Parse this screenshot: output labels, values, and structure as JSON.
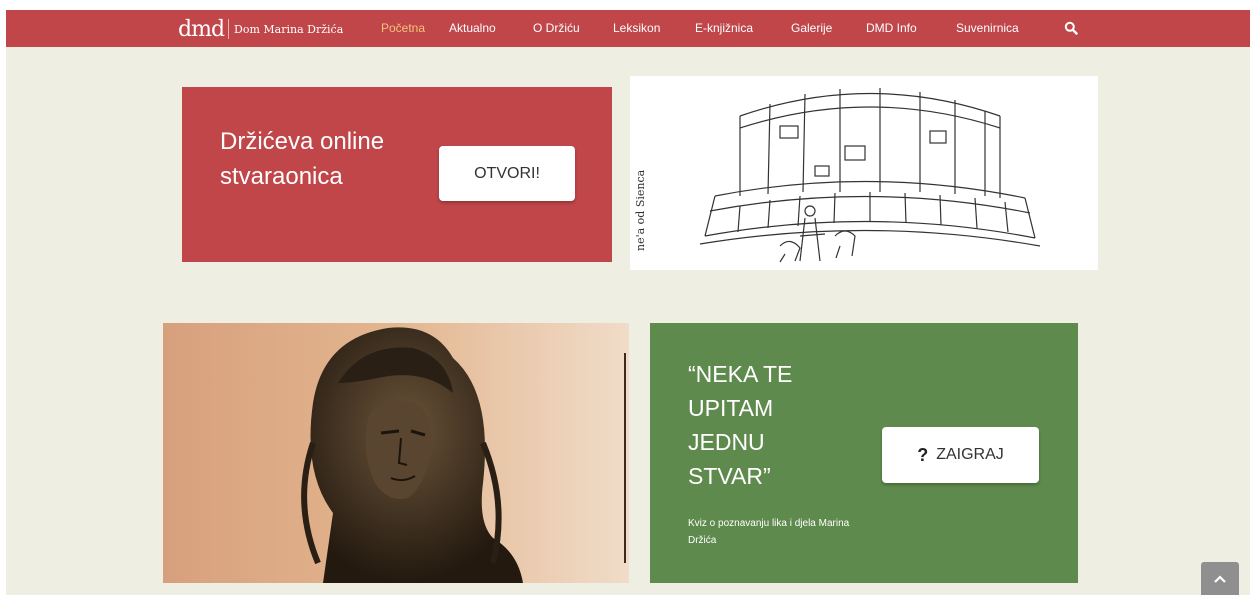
{
  "header": {
    "logo_mark": "dmd",
    "logo_name": "Dom Marina Držića",
    "nav": [
      {
        "label": "Početna",
        "active": true
      },
      {
        "label": "Aktualno",
        "active": false
      },
      {
        "label": "O Držiću",
        "active": false
      },
      {
        "label": "Leksikon",
        "active": false
      },
      {
        "label": "E-knjižnica",
        "active": false
      },
      {
        "label": "Galerije",
        "active": false
      },
      {
        "label": "DMD Info",
        "active": false
      },
      {
        "label": "Suvenirnica",
        "active": false
      }
    ],
    "search_icon": "search-icon"
  },
  "workshop_card": {
    "heading": "Držićeva online stvaraonica",
    "button_label": "OTVORI!"
  },
  "sketch": {
    "caption": "ne'a od Sienca"
  },
  "quiz_card": {
    "heading": "“NEKA TE UPITAM JEDNU STVAR”",
    "button_icon": "?",
    "button_label": "ZAIGRAJ",
    "description": "Kviz o poznavanju lika i djela Marina Držića"
  },
  "colors": {
    "brand_red": "#c0464a",
    "page_bg": "#efeee2",
    "quiz_green": "#5f8a4d",
    "active_nav": "#f3c47a"
  },
  "scroll_top_icon": "chevron-up-icon"
}
